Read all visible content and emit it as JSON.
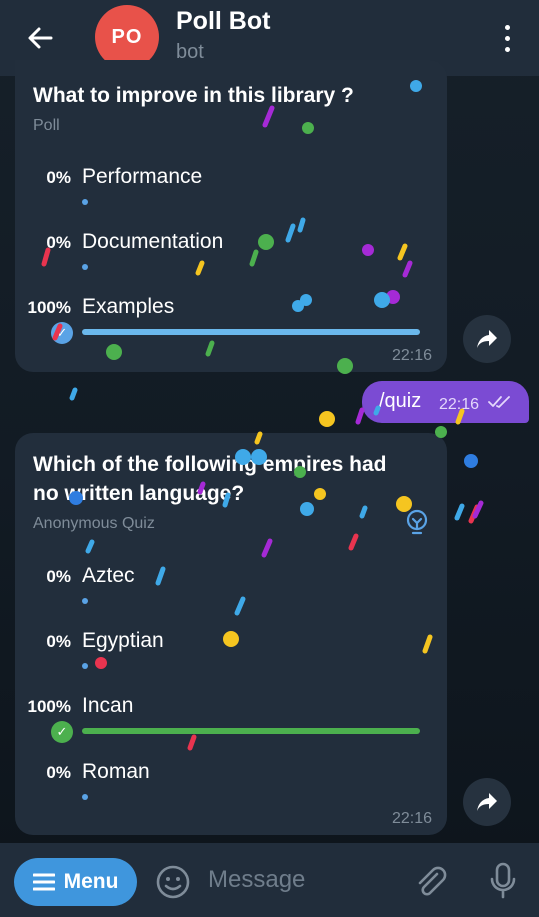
{
  "header": {
    "avatar_initials": "PO",
    "title": "Poll Bot",
    "subtitle": "bot",
    "back_icon": "arrow-left-icon",
    "more_icon": "more-vertical-icon"
  },
  "poll1": {
    "question": "What to improve in this library ?",
    "type_label": "Poll",
    "options": [
      {
        "percent": "0%",
        "label": "Performance",
        "fraction": 0
      },
      {
        "percent": "0%",
        "label": "Documentation",
        "fraction": 0
      },
      {
        "percent": "100%",
        "label": "Examples",
        "fraction": 1,
        "selected": true
      }
    ],
    "time": "22:16"
  },
  "outgoing": {
    "text": "/quiz",
    "time": "22:16",
    "status_icon": "double-check-icon"
  },
  "poll2": {
    "question_line1": "Which of the following empires had",
    "question_line2": "no written language?",
    "type_label": "Anonymous Quiz",
    "options": [
      {
        "percent": "0%",
        "label": "Aztec",
        "fraction": 0
      },
      {
        "percent": "0%",
        "label": "Egyptian",
        "fraction": 0
      },
      {
        "percent": "100%",
        "label": "Incan",
        "fraction": 1,
        "correct": true
      },
      {
        "percent": "0%",
        "label": "Roman",
        "fraction": 0
      }
    ],
    "time": "22:16",
    "hint_icon": "lightbulb-icon"
  },
  "bottom": {
    "menu_label": "Menu",
    "message_placeholder": "Message"
  },
  "colors": {
    "header_bg": "#212d3b",
    "bubble_bg": "#222e3c",
    "accent_blue": "#5aa3e6",
    "poll_bar": "#6bb8ec",
    "quiz_bar": "#4cb04e",
    "outgoing_bg": "#7b4bd3",
    "avatar_bg": "#e8524a",
    "menu_button_bg": "#3f96dd"
  }
}
